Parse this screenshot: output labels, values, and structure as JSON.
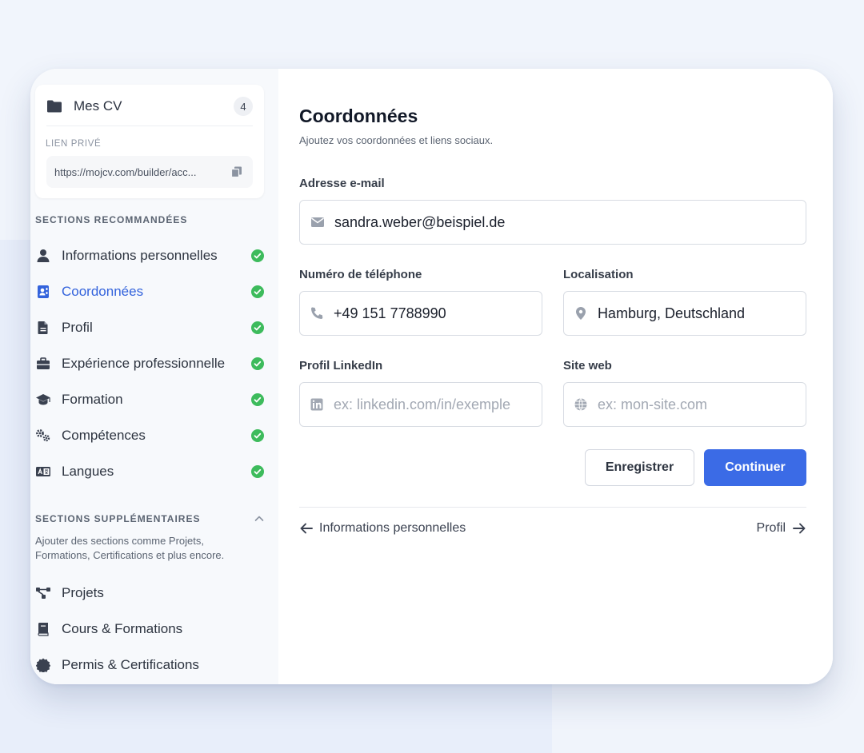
{
  "sidebar": {
    "mes_cv": {
      "title": "Mes CV",
      "count": "4"
    },
    "lien_prive": {
      "label": "LIEN PRIVÉ",
      "url": "https://mojcv.com/builder/acc..."
    },
    "recommended_heading": "SECTIONS RECOMMANDÉES",
    "recommended_items": [
      {
        "label": "Informations personnelles",
        "icon": "user-icon",
        "completed": true
      },
      {
        "label": "Coordonnées",
        "icon": "contact-card-icon",
        "completed": true,
        "active": true
      },
      {
        "label": "Profil",
        "icon": "document-icon",
        "completed": true
      },
      {
        "label": "Expérience professionnelle",
        "icon": "briefcase-icon",
        "completed": true
      },
      {
        "label": "Formation",
        "icon": "graduation-cap-icon",
        "completed": true
      },
      {
        "label": "Compétences",
        "icon": "gears-icon",
        "completed": true
      },
      {
        "label": "Langues",
        "icon": "language-icon",
        "completed": true
      }
    ],
    "supplementary_heading": "SECTIONS SUPPLÉMENTAIRES",
    "supplementary_description": "Ajouter des sections comme Projets, Formations, Certifications et plus encore.",
    "supplementary_items": [
      {
        "label": "Projets",
        "icon": "project-icon"
      },
      {
        "label": "Cours & Formations",
        "icon": "book-icon"
      },
      {
        "label": "Permis & Certifications",
        "icon": "certificate-icon"
      }
    ]
  },
  "main": {
    "title": "Coordonnées",
    "subtitle": "Ajoutez vos coordonnées et liens sociaux.",
    "email": {
      "label": "Adresse e-mail",
      "value": "sandra.weber@beispiel.de",
      "icon": "envelope-icon"
    },
    "phone": {
      "label": "Numéro de téléphone",
      "value": "+49 151 7788990",
      "icon": "phone-icon"
    },
    "location": {
      "label": "Localisation",
      "value": "Hamburg, Deutschland",
      "icon": "location-pin-icon"
    },
    "linkedin": {
      "label": "Profil LinkedIn",
      "value": "",
      "placeholder": "ex: linkedin.com/in/exemple",
      "icon": "linkedin-icon"
    },
    "website": {
      "label": "Site web",
      "value": "",
      "placeholder": "ex: mon-site.com",
      "icon": "globe-icon"
    },
    "save_label": "Enregistrer",
    "continue_label": "Continuer",
    "prev_label": "Informations personnelles",
    "next_label": "Profil"
  },
  "colors": {
    "accent": "#3b6be6",
    "active_text": "#3363dc",
    "check_green": "#3dbb5c"
  }
}
